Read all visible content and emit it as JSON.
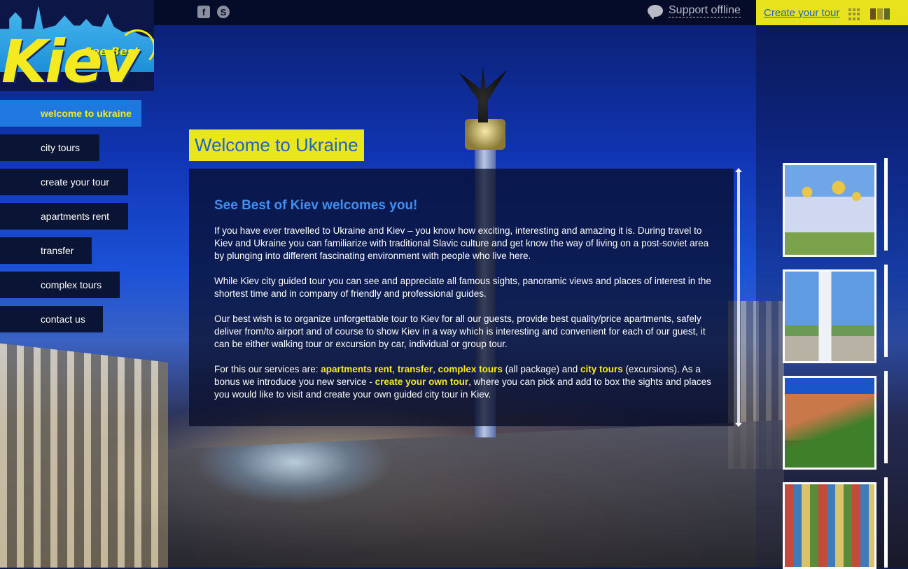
{
  "logo": {
    "main": "Kiev",
    "tag": "See Best of"
  },
  "topbar": {
    "social": [
      {
        "icon": "facebook-icon",
        "glyph": "f"
      },
      {
        "icon": "skype-icon",
        "glyph": "S"
      }
    ],
    "support_text": "Support offline",
    "create_tour_link": "Create your tour",
    "tile_colors": [
      "#6b4e1d",
      "#a39a2a",
      "#5e6a1f"
    ]
  },
  "nav": [
    {
      "label": "welcome to ukraine",
      "active": true
    },
    {
      "label": "city tours"
    },
    {
      "label": "create your tour"
    },
    {
      "label": "apartments rent"
    },
    {
      "label": "transfer"
    },
    {
      "label": "complex tours"
    },
    {
      "label": "contact us"
    }
  ],
  "page": {
    "title": "Welcome to Ukraine",
    "heading": "See Best of Kiev welcomes you!",
    "p1": "If you have ever travelled to Ukraine and Kiev – you know how exciting, interesting and amazing it is. During travel to Kiev and Ukraine you can familiarize with traditional Slavic culture and get know the way of living on a post-soviet area by plunging into different fascinating environment with people who live here.",
    "p2": "While Kiev city guided tour you can see and appreciate all famous sights, panoramic views and places of interest in the shortest time and in company of friendly and professional guides.",
    "p3": "Our best wish is to organize unforgettable tour to Kiev for all our guests, provide best quality/price apartments, safely deliver from/to airport and of course to show Kiev in a way which is interesting and convenient for each of our guest, it can be either walking tour or excursion by car, individual or group tour.",
    "p4": {
      "intro": "For this our services are: ",
      "link_apartments": "apartments rent",
      "sep1": ", ",
      "link_transfer": "transfer",
      "sep2": ", ",
      "link_complex": "complex tours",
      "mid1": " (all package) and ",
      "link_city": "city tours",
      "mid2": " (excursions). As a bonus  we introduce you new service - ",
      "link_create": "create your own tour",
      "outro": ", where you can pick and add to box the sights and places you would like to visit and create your own guided city tour in Kiev."
    }
  },
  "colors": {
    "accent_yellow": "#eae61d",
    "nav_active": "#1f78e0",
    "heading_blue": "#3f8ef0",
    "link_blue": "#2063b8"
  }
}
